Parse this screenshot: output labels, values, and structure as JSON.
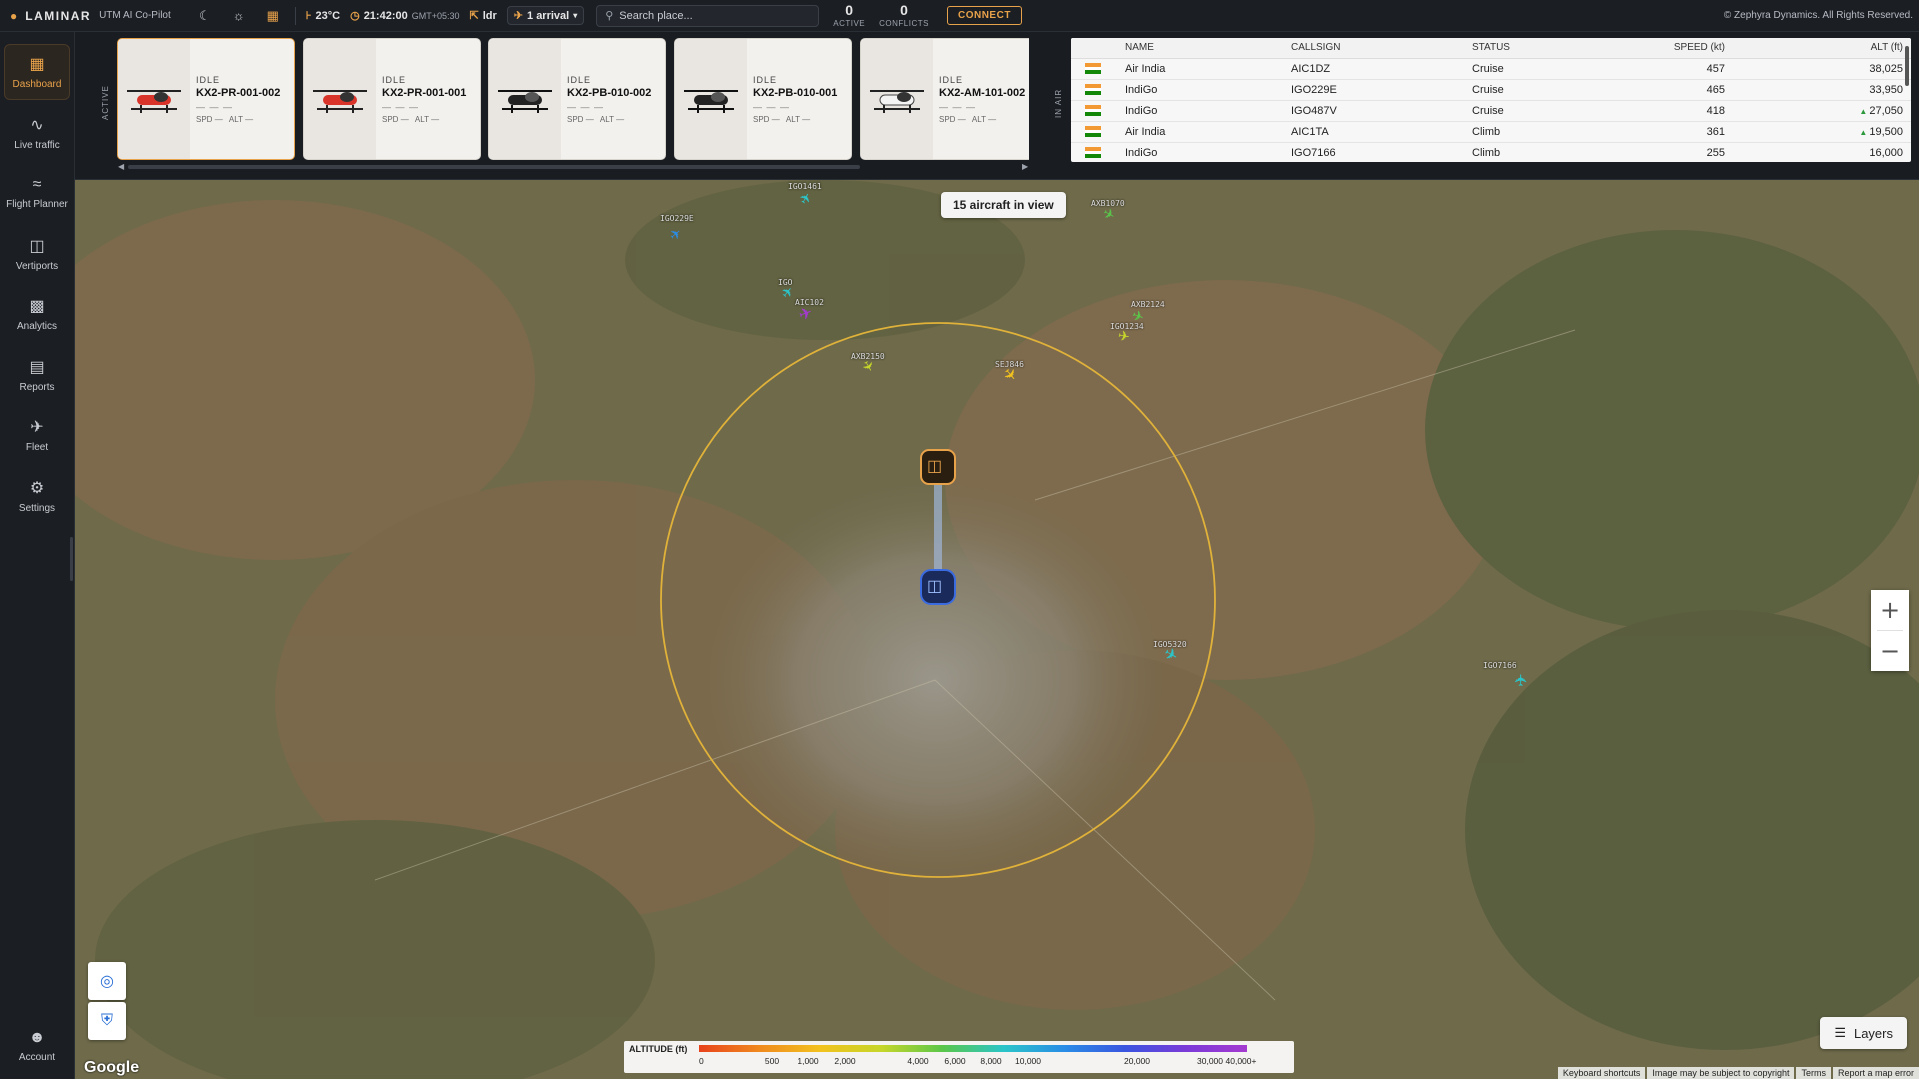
{
  "topbar": {
    "brand": "LAMINAR",
    "subtitle": "UTM AI Co-Pilot",
    "temperature": "23°C",
    "time": "21:42:00",
    "timezone": "GMT+05:30",
    "location": "ldr",
    "arrivals": "1 arrival",
    "search_placeholder": "Search place...",
    "active_count": "0",
    "active_label": "ACTIVE",
    "conflicts_count": "0",
    "conflicts_label": "CONFLICTS",
    "connect_label": "CONNECT",
    "copyright": "© Zephyra Dynamics. All Rights Reserved."
  },
  "sidebar": {
    "items": [
      {
        "label": "Dashboard",
        "icon": "dashboard-icon"
      },
      {
        "label": "Live traffic",
        "icon": "activity-icon"
      },
      {
        "label": "Flight Planner",
        "icon": "route-icon"
      },
      {
        "label": "Vertiports",
        "icon": "building-icon"
      },
      {
        "label": "Analytics",
        "icon": "bar-chart-icon"
      },
      {
        "label": "Reports",
        "icon": "document-icon"
      },
      {
        "label": "Fleet",
        "icon": "plane-icon"
      },
      {
        "label": "Settings",
        "icon": "gear-icon"
      }
    ],
    "account_label": "Account"
  },
  "fleet": {
    "section_label": "ACTIVE",
    "cards": [
      {
        "status": "IDLE",
        "reg": "KX2-PR-001-002",
        "dashes": "— — —",
        "spd_label": "SPD",
        "spd": "—",
        "alt_label": "ALT",
        "alt": "—",
        "color": "#d8342a"
      },
      {
        "status": "IDLE",
        "reg": "KX2-PR-001-001",
        "dashes": "— — —",
        "spd_label": "SPD",
        "spd": "—",
        "alt_label": "ALT",
        "alt": "—",
        "color": "#d8342a"
      },
      {
        "status": "IDLE",
        "reg": "KX2-PB-010-002",
        "dashes": "— — —",
        "spd_label": "SPD",
        "spd": "—",
        "alt_label": "ALT",
        "alt": "—",
        "color": "#222222"
      },
      {
        "status": "IDLE",
        "reg": "KX2-PB-010-001",
        "dashes": "— — —",
        "spd_label": "SPD",
        "spd": "—",
        "alt_label": "ALT",
        "alt": "—",
        "color": "#222222"
      },
      {
        "status": "IDLE",
        "reg": "KX2-AM-101-002",
        "dashes": "— — —",
        "spd_label": "SPD",
        "spd": "—",
        "alt_label": "ALT",
        "alt": "—",
        "color": "#eeeeee"
      }
    ]
  },
  "traffic": {
    "section_label": "IN AIR",
    "columns": [
      "NAME",
      "CALLSIGN",
      "STATUS",
      "SPEED (kt)",
      "ALT (ft)"
    ],
    "rows": [
      {
        "name": "Air India",
        "callsign": "AIC1DZ",
        "status": "Cruise",
        "speed": "457",
        "alt": "38,025",
        "climb": false
      },
      {
        "name": "IndiGo",
        "callsign": "IGO229E",
        "status": "Cruise",
        "speed": "465",
        "alt": "33,950",
        "climb": false
      },
      {
        "name": "IndiGo",
        "callsign": "IGO487V",
        "status": "Cruise",
        "speed": "418",
        "alt": "27,050",
        "climb": true
      },
      {
        "name": "Air India",
        "callsign": "AIC1TA",
        "status": "Climb",
        "speed": "361",
        "alt": "19,500",
        "climb": true
      },
      {
        "name": "IndiGo",
        "callsign": "IGO7166",
        "status": "Climb",
        "speed": "255",
        "alt": "16,000",
        "climb": false
      }
    ]
  },
  "map": {
    "aircraft_in_view": "15 aircraft in view",
    "aircraft_labels": [
      "IGO1461",
      "IGO229E",
      "AXB1070",
      "IGO",
      "AIC102",
      "AXB2150",
      "AXB2124",
      "IGO1234",
      "SEJ846",
      "IGO5320",
      "IGO7166"
    ],
    "layers_label": "Layers",
    "google_label": "Google",
    "legend_title": "ALTITUDE (ft)",
    "legend_ticks": [
      "0",
      "500",
      "1,000",
      "2,000",
      "4,000",
      "6,000",
      "8,000",
      "10,000",
      "20,000",
      "30,000",
      "40,000+"
    ],
    "attribution": [
      "Keyboard shortcuts",
      "Image may be subject to copyright",
      "Terms",
      "Report a map error"
    ]
  }
}
